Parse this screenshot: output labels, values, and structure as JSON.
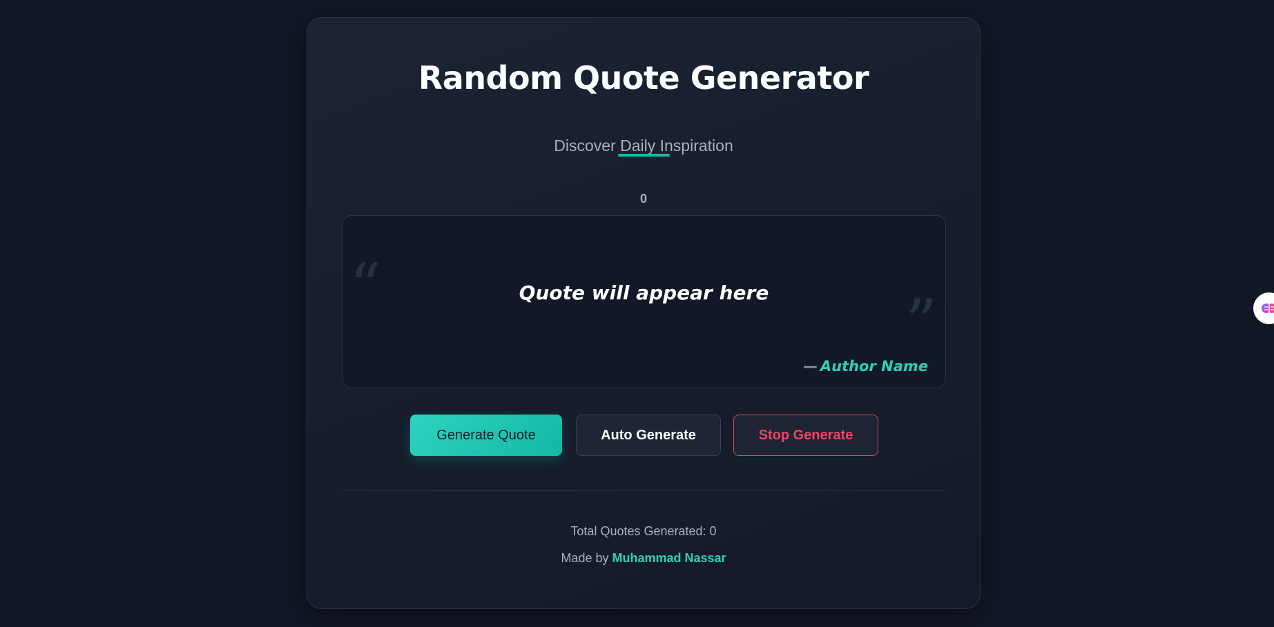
{
  "app": {
    "title": "Random Quote Generator",
    "subtitle": "Discover Daily Inspiration",
    "counter": "0"
  },
  "quote": {
    "open_mark": "“",
    "close_mark": "”",
    "text": "Quote will appear here",
    "dash": "—",
    "author": "Author Name"
  },
  "buttons": {
    "generate_label": "Generate Quote",
    "auto_label": "Auto Generate",
    "stop_label": "Stop Generate"
  },
  "footer": {
    "total_label": "Total Quotes Generated: 0",
    "made_by": "Made by",
    "author_name": "Muhammad Nassar"
  },
  "colors": {
    "background": "#131827",
    "accent": "#2dd4bf",
    "danger": "#f14462"
  },
  "icons": {
    "side_widget": "brain-extension-icon"
  }
}
